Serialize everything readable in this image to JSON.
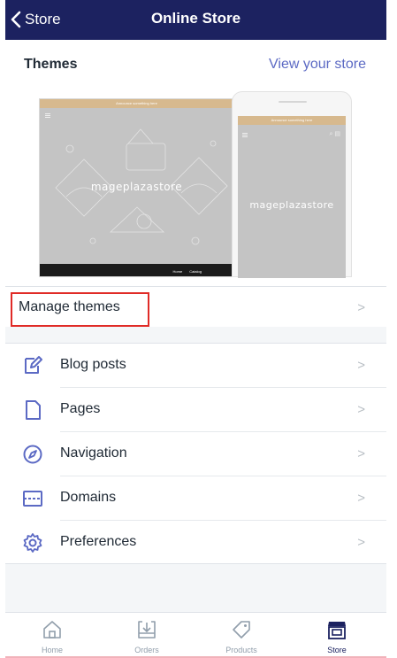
{
  "header": {
    "back_label": "Store",
    "title": "Online Store",
    "background": "#1c2260"
  },
  "themes": {
    "heading": "Themes",
    "view_store_link": "View your store",
    "preview": {
      "banner_text": "Announce something here",
      "store_name": "mageplazastore",
      "footer_links": [
        "Home",
        "Catalog"
      ]
    },
    "manage_label": "Manage themes",
    "highlight_color": "#e02b27"
  },
  "menu": {
    "items": [
      {
        "label": "Blog posts",
        "icon": "blog-post-icon"
      },
      {
        "label": "Pages",
        "icon": "page-icon"
      },
      {
        "label": "Navigation",
        "icon": "navigation-compass-icon"
      },
      {
        "label": "Domains",
        "icon": "domains-icon"
      },
      {
        "label": "Preferences",
        "icon": "gear-icon"
      }
    ],
    "chevron": ">"
  },
  "tab_bar": {
    "tabs": [
      {
        "label": "Home",
        "icon": "home-icon",
        "active": false
      },
      {
        "label": "Orders",
        "icon": "orders-icon",
        "active": false
      },
      {
        "label": "Products",
        "icon": "tag-icon",
        "active": false
      },
      {
        "label": "Store",
        "icon": "store-icon",
        "active": true
      }
    ],
    "active_color": "#1c2260"
  }
}
